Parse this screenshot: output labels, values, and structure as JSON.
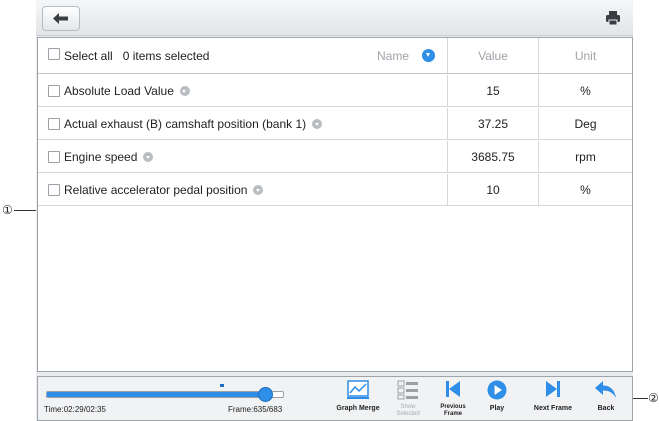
{
  "callouts": {
    "left": "①",
    "right": "②"
  },
  "topbar": {
    "back_icon": "back-arrow-icon",
    "print_icon": "printer-icon"
  },
  "list": {
    "select_all_label": "Select all",
    "selected_count": "0 items selected",
    "col_name": "Name",
    "col_value": "Value",
    "col_unit": "Unit",
    "rows": [
      {
        "name": "Absolute Load Value",
        "value": "15",
        "unit": "%"
      },
      {
        "name": "Actual exhaust (B) camshaft position (bank 1)",
        "value": "37.25",
        "unit": "Deg"
      },
      {
        "name": "Engine speed",
        "value": "3685.75",
        "unit": "rpm"
      },
      {
        "name": "Relative accelerator pedal position",
        "value": "10",
        "unit": "%"
      }
    ]
  },
  "playback": {
    "time": "Time:02:29/02:35",
    "frame": "Frame:635/683",
    "progress": 0.93,
    "buttons": {
      "graph_merge": "Graph Merge",
      "show_selected_1": "Show",
      "show_selected_2": "Selected",
      "previous_frame_1": "Previous",
      "previous_frame_2": "Frame",
      "play": "Play",
      "next_frame": "Next Frame",
      "back": "Back"
    }
  },
  "colors": {
    "accent": "#2e8ee8",
    "panel_border": "#9fa4aa",
    "disabled": "#a7abb0"
  }
}
